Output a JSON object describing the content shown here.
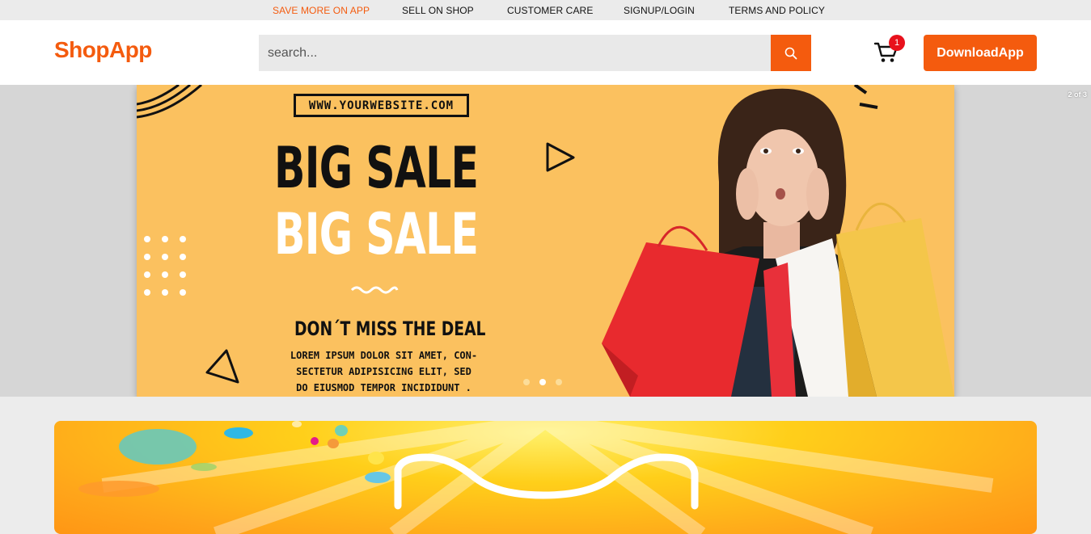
{
  "topbar": {
    "links": [
      {
        "label": "SAVE MORE ON APP"
      },
      {
        "label": "SELL ON SHOP"
      },
      {
        "label": "CUSTOMER CARE"
      },
      {
        "label": "SIGNUP/LOGIN"
      },
      {
        "label": "TERMS AND POLICY"
      }
    ]
  },
  "header": {
    "logo": "ShopApp",
    "search_placeholder": "search...",
    "cart_count": "1",
    "download_label": "DownloadApp"
  },
  "hero": {
    "slide_counter": "2 of 3",
    "website": "WWW.YOURWEBSITE.COM",
    "headline_1": "BIG SALE",
    "headline_2": "BIG SALE",
    "deal_text": "DON´T MISS THE DEAL",
    "body_text": "LOREM IPSUM DOLOR SIT AMET, CON-SECTETUR ADIPISICING ELIT, SED DO EIUSMOD TEMPOR INCIDIDUNT .",
    "slides_total": 3,
    "active_slide": 2
  },
  "colors": {
    "accent": "#f45b0e",
    "badge": "#e8111c",
    "hero_bg": "#fbc15f"
  }
}
